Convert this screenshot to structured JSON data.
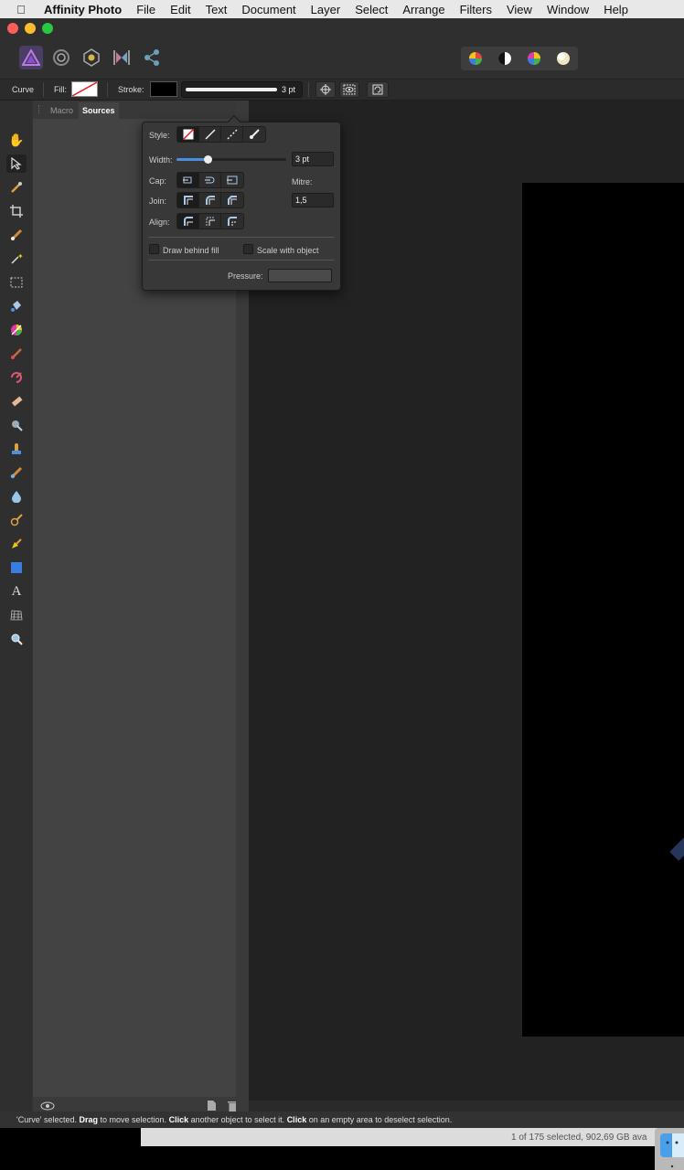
{
  "menubar": {
    "app": "Affinity Photo",
    "items": [
      "File",
      "Edit",
      "Text",
      "Document",
      "Layer",
      "Select",
      "Arrange",
      "Filters",
      "View",
      "Window",
      "Help"
    ]
  },
  "personas": [
    "photo-persona",
    "liquify-persona",
    "develop-persona",
    "tone-mapping-persona",
    "export-persona"
  ],
  "context": {
    "object": "Curve",
    "fill_label": "Fill:",
    "stroke_label": "Stroke:",
    "stroke_width": "3 pt"
  },
  "panel": {
    "tabs": [
      "Macro",
      "Sources"
    ],
    "active_tab": "Sources"
  },
  "stroke_popover": {
    "style_label": "Style:",
    "width_label": "Width:",
    "width_value": "3 pt",
    "width_slider_fraction": 0.28,
    "cap_label": "Cap:",
    "join_label": "Join:",
    "mitre_label": "Mitre:",
    "mitre_value": "1,5",
    "align_label": "Align:",
    "draw_behind_fill": "Draw behind fill",
    "scale_with_object": "Scale with object",
    "pressure_label": "Pressure:"
  },
  "status": {
    "quote": "'Curve' selected.",
    "drag": "Drag",
    "drag_text": "to move selection.",
    "click1": "Click",
    "click1_text": "another object to select it.",
    "click2": "Click",
    "click2_text": "on an empty area to deselect selection."
  },
  "finder_status": "1 of 175 selected, 902,69 GB ava",
  "colors": {
    "accent": "#4a90e2",
    "canvas_bg": "#222222",
    "panel_bg": "#434343"
  }
}
